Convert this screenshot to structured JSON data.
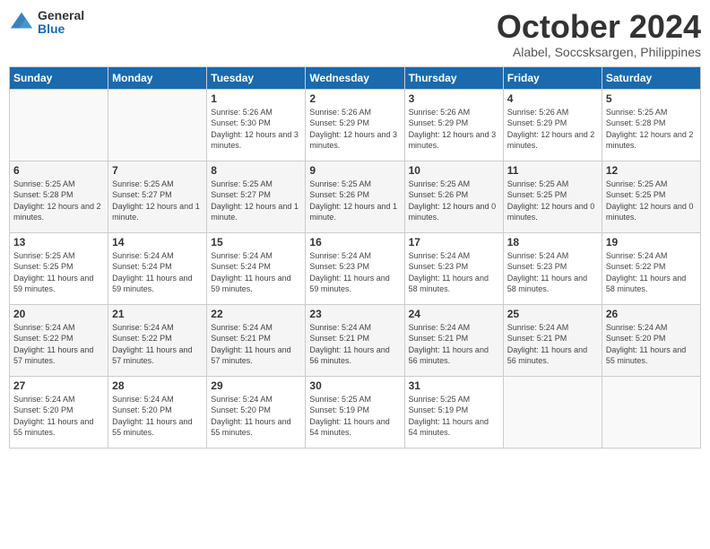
{
  "logo": {
    "general": "General",
    "blue": "Blue"
  },
  "title": "October 2024",
  "subtitle": "Alabel, Soccsksargen, Philippines",
  "headers": [
    "Sunday",
    "Monday",
    "Tuesday",
    "Wednesday",
    "Thursday",
    "Friday",
    "Saturday"
  ],
  "weeks": [
    [
      {
        "day": "",
        "info": ""
      },
      {
        "day": "",
        "info": ""
      },
      {
        "day": "1",
        "info": "Sunrise: 5:26 AM\nSunset: 5:30 PM\nDaylight: 12 hours and 3 minutes."
      },
      {
        "day": "2",
        "info": "Sunrise: 5:26 AM\nSunset: 5:29 PM\nDaylight: 12 hours and 3 minutes."
      },
      {
        "day": "3",
        "info": "Sunrise: 5:26 AM\nSunset: 5:29 PM\nDaylight: 12 hours and 3 minutes."
      },
      {
        "day": "4",
        "info": "Sunrise: 5:26 AM\nSunset: 5:29 PM\nDaylight: 12 hours and 2 minutes."
      },
      {
        "day": "5",
        "info": "Sunrise: 5:25 AM\nSunset: 5:28 PM\nDaylight: 12 hours and 2 minutes."
      }
    ],
    [
      {
        "day": "6",
        "info": "Sunrise: 5:25 AM\nSunset: 5:28 PM\nDaylight: 12 hours and 2 minutes."
      },
      {
        "day": "7",
        "info": "Sunrise: 5:25 AM\nSunset: 5:27 PM\nDaylight: 12 hours and 1 minute."
      },
      {
        "day": "8",
        "info": "Sunrise: 5:25 AM\nSunset: 5:27 PM\nDaylight: 12 hours and 1 minute."
      },
      {
        "day": "9",
        "info": "Sunrise: 5:25 AM\nSunset: 5:26 PM\nDaylight: 12 hours and 1 minute."
      },
      {
        "day": "10",
        "info": "Sunrise: 5:25 AM\nSunset: 5:26 PM\nDaylight: 12 hours and 0 minutes."
      },
      {
        "day": "11",
        "info": "Sunrise: 5:25 AM\nSunset: 5:25 PM\nDaylight: 12 hours and 0 minutes."
      },
      {
        "day": "12",
        "info": "Sunrise: 5:25 AM\nSunset: 5:25 PM\nDaylight: 12 hours and 0 minutes."
      }
    ],
    [
      {
        "day": "13",
        "info": "Sunrise: 5:25 AM\nSunset: 5:25 PM\nDaylight: 11 hours and 59 minutes."
      },
      {
        "day": "14",
        "info": "Sunrise: 5:24 AM\nSunset: 5:24 PM\nDaylight: 11 hours and 59 minutes."
      },
      {
        "day": "15",
        "info": "Sunrise: 5:24 AM\nSunset: 5:24 PM\nDaylight: 11 hours and 59 minutes."
      },
      {
        "day": "16",
        "info": "Sunrise: 5:24 AM\nSunset: 5:23 PM\nDaylight: 11 hours and 59 minutes."
      },
      {
        "day": "17",
        "info": "Sunrise: 5:24 AM\nSunset: 5:23 PM\nDaylight: 11 hours and 58 minutes."
      },
      {
        "day": "18",
        "info": "Sunrise: 5:24 AM\nSunset: 5:23 PM\nDaylight: 11 hours and 58 minutes."
      },
      {
        "day": "19",
        "info": "Sunrise: 5:24 AM\nSunset: 5:22 PM\nDaylight: 11 hours and 58 minutes."
      }
    ],
    [
      {
        "day": "20",
        "info": "Sunrise: 5:24 AM\nSunset: 5:22 PM\nDaylight: 11 hours and 57 minutes."
      },
      {
        "day": "21",
        "info": "Sunrise: 5:24 AM\nSunset: 5:22 PM\nDaylight: 11 hours and 57 minutes."
      },
      {
        "day": "22",
        "info": "Sunrise: 5:24 AM\nSunset: 5:21 PM\nDaylight: 11 hours and 57 minutes."
      },
      {
        "day": "23",
        "info": "Sunrise: 5:24 AM\nSunset: 5:21 PM\nDaylight: 11 hours and 56 minutes."
      },
      {
        "day": "24",
        "info": "Sunrise: 5:24 AM\nSunset: 5:21 PM\nDaylight: 11 hours and 56 minutes."
      },
      {
        "day": "25",
        "info": "Sunrise: 5:24 AM\nSunset: 5:21 PM\nDaylight: 11 hours and 56 minutes."
      },
      {
        "day": "26",
        "info": "Sunrise: 5:24 AM\nSunset: 5:20 PM\nDaylight: 11 hours and 55 minutes."
      }
    ],
    [
      {
        "day": "27",
        "info": "Sunrise: 5:24 AM\nSunset: 5:20 PM\nDaylight: 11 hours and 55 minutes."
      },
      {
        "day": "28",
        "info": "Sunrise: 5:24 AM\nSunset: 5:20 PM\nDaylight: 11 hours and 55 minutes."
      },
      {
        "day": "29",
        "info": "Sunrise: 5:24 AM\nSunset: 5:20 PM\nDaylight: 11 hours and 55 minutes."
      },
      {
        "day": "30",
        "info": "Sunrise: 5:25 AM\nSunset: 5:19 PM\nDaylight: 11 hours and 54 minutes."
      },
      {
        "day": "31",
        "info": "Sunrise: 5:25 AM\nSunset: 5:19 PM\nDaylight: 11 hours and 54 minutes."
      },
      {
        "day": "",
        "info": ""
      },
      {
        "day": "",
        "info": ""
      }
    ]
  ]
}
